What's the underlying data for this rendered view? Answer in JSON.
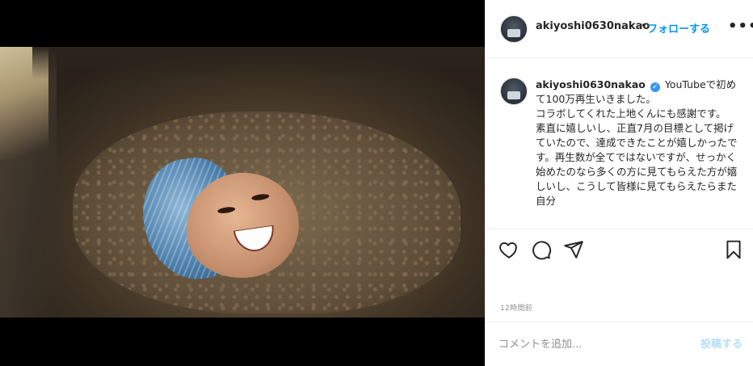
{
  "header": {
    "username": "akiyoshi0630nakao",
    "separator": "•",
    "follow_label": "フォローする",
    "more_label": "•••"
  },
  "caption": {
    "username": "akiyoshi0630nakao",
    "verified_icon": "verified-badge-icon",
    "lines": [
      "YouTubeで初めて100万再生いきました。",
      "コラボしてくれた上地くんにも感謝です。",
      "素直に嬉しいし、正直7月の目標として掲げていたので、達成できたことが嬉しかったです。再生数が全てではないですが、せっかく始めたのなら多くの方に見てもらえた方が嬉しいし、こうして皆様に見てもらえたらまた自分"
    ]
  },
  "actions": {
    "icons": [
      "heart-icon",
      "comment-icon",
      "share-icon",
      "bookmark-icon"
    ]
  },
  "timestamp": "12時間前",
  "comment_box": {
    "placeholder": "コメントを追加...",
    "post_label": "投稿する"
  },
  "colors": {
    "accent": "#0095f6",
    "post_disabled": "#b2dffc",
    "verified": "#3897f0",
    "muted": "#8e8e8e"
  }
}
